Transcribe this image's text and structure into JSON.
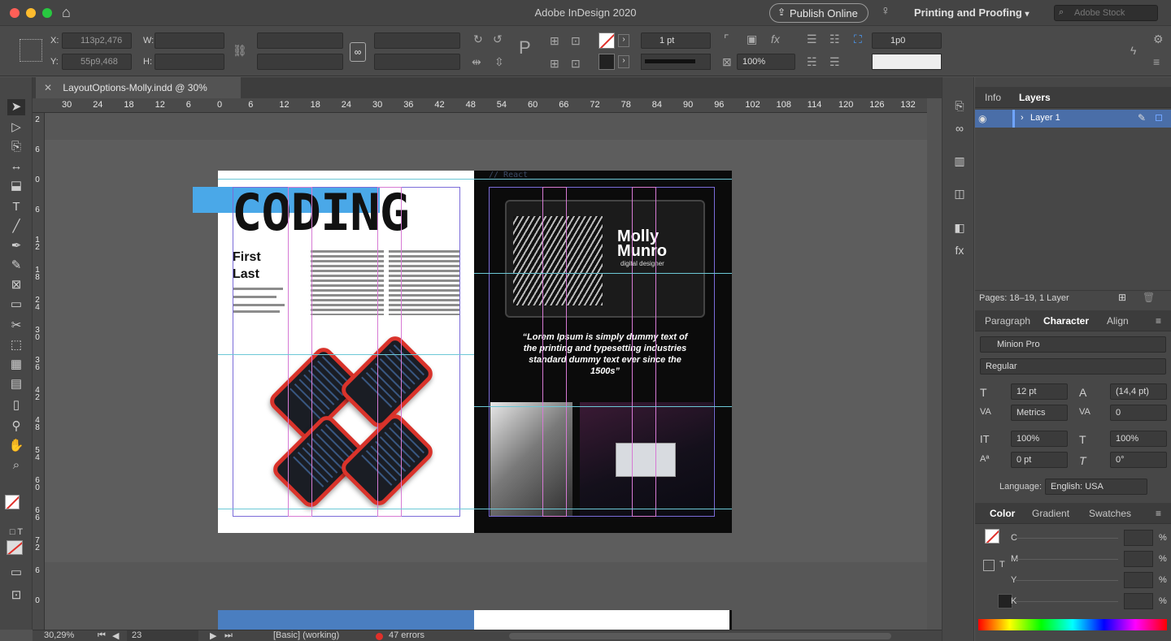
{
  "window": {
    "title": "Adobe InDesign 2020",
    "publish_label": "Publish Online",
    "workspace": "Printing and Proofing",
    "stock_placeholder": "Adobe Stock"
  },
  "control": {
    "x_label": "X:",
    "x_value": "113p2,476",
    "y_label": "Y:",
    "y_value": "55p9,468",
    "w_label": "W:",
    "h_label": "H:",
    "stroke_weight": "1 pt",
    "opacity": "100%",
    "gutter": "1p0"
  },
  "tab": {
    "title": "LayoutOptions-Molly.indd @ 30%"
  },
  "ruler": {
    "marks": [
      "30",
      "24",
      "18",
      "12",
      "6",
      "0",
      "6",
      "12",
      "18",
      "24",
      "30",
      "36",
      "42",
      "48",
      "54",
      "60",
      "66",
      "72",
      "78",
      "84",
      "90",
      "96",
      "102",
      "108",
      "114",
      "120",
      "126",
      "132"
    ],
    "vmarks": [
      "2",
      "6",
      "0",
      "6",
      "1 2",
      "1 8",
      "2 4",
      "3 0",
      "3 6",
      "4 2",
      "4 8",
      "5 4",
      "6 0",
      "6 6",
      "7 2",
      "6",
      "0"
    ]
  },
  "page": {
    "heading": "CODING",
    "name_line1": "First",
    "name_line2": "Last",
    "quote": "“Lorem Ipsum is simply dummy text of the printing and typesetting industries standard dummy text ever since the 1500s”",
    "laptop_brand_line1": "Molly",
    "laptop_brand_line2": "Munro",
    "laptop_subtitle": "digital designer",
    "code_snippet": "// React"
  },
  "status": {
    "zoom": "30,29%",
    "page": "23",
    "profile": "[Basic] (working)",
    "errors": "47 errors"
  },
  "layers": {
    "tabs": [
      "Info",
      "Layers"
    ],
    "layer_name": "Layer 1",
    "footer": "Pages: 18–19, 1 Layer"
  },
  "character": {
    "tabs": [
      "Paragraph",
      "Character",
      "Align"
    ],
    "font": "Minion Pro",
    "style": "Regular",
    "size": "12 pt",
    "leading": "(14,4 pt)",
    "kerning": "Metrics",
    "tracking": "0",
    "vscale": "100%",
    "hscale": "100%",
    "baseline": "0 pt",
    "skew": "0°",
    "language_label": "Language:",
    "language": "English: USA"
  },
  "color": {
    "tabs": [
      "Color",
      "Gradient",
      "Swatches"
    ],
    "channels": [
      "C",
      "M",
      "Y",
      "K"
    ],
    "unit": "%"
  },
  "colors": {
    "accent_blue": "#4aa8e8",
    "selection_blue": "#4a6ea8",
    "error_red": "#e0302a"
  }
}
